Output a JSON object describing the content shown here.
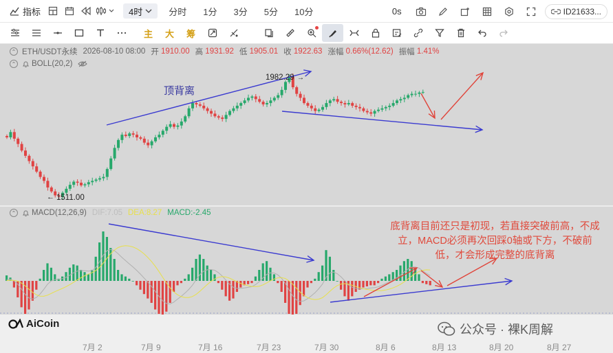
{
  "toolbar": {
    "indicator_label": "指标",
    "timeframes": [
      "4时",
      "分时",
      "1分",
      "3分",
      "5分",
      "10分"
    ],
    "active_timeframe": "4时",
    "countdown": "0s",
    "account": "ID21633..."
  },
  "drawbar": {
    "chinese_buttons": [
      "主",
      "大",
      "筹"
    ]
  },
  "legend": {
    "pair": "ETH/USDT永续",
    "datetime": "2026-08-10 08:00",
    "open_label": "开",
    "open": "1910.00",
    "high_label": "高",
    "high": "1931.92",
    "low_label": "低",
    "low": "1905.01",
    "close_label": "收",
    "close": "1922.63",
    "change_label": "涨幅",
    "change": "0.66%(12.62)",
    "amplitude_label": "振幅",
    "amplitude": "1.41%",
    "boll": "BOLL(20,2)",
    "macd": "MACD(12,26,9)",
    "dif": "DIF:7.05",
    "dea": "DEA:8.27",
    "macd_val": "MACD:-2.45"
  },
  "annotations": {
    "top_divergence": "顶背离",
    "high_price": "1982.29",
    "low_price": "1511.00",
    "bottom_note": "底背离目前还只是初现，若直接突破前高，不成立，MACD必须再次回踩0轴或下方，不破前低，才会形成完整的底背离"
  },
  "x_axis": [
    "7月 2",
    "7月 9",
    "7月 16",
    "7月 23",
    "7月 30",
    "8月 6",
    "8月 13",
    "8月 20",
    "8月 27"
  ],
  "brand": {
    "logo_text": "AiCoin",
    "watermark": "公众号 · 裸K周解"
  },
  "colors": {
    "up": "#27a86b",
    "down": "#e04343",
    "arrow_blue": "#3a3ad0",
    "arrow_red": "#e0443a",
    "dif": "#b0b0b0",
    "dea": "#e8e04a"
  },
  "chart_data": [
    {
      "type": "candlestick",
      "title": "",
      "high_label": "1982.29",
      "low_label": "1511.00",
      "close": [
        1750,
        1770,
        1745,
        1725,
        1700,
        1680,
        1660,
        1640,
        1620,
        1600,
        1585,
        1560,
        1545,
        1530,
        1525,
        1540,
        1555,
        1570,
        1582,
        1578,
        1568,
        1572,
        1580,
        1585,
        1590,
        1595,
        1600,
        1630,
        1670,
        1710,
        1740,
        1760,
        1755,
        1765,
        1760,
        1750,
        1745,
        1730,
        1720,
        1735,
        1750,
        1760,
        1775,
        1790,
        1800,
        1790,
        1795,
        1810,
        1830,
        1860,
        1880,
        1875,
        1870,
        1860,
        1850,
        1840,
        1830,
        1825,
        1820,
        1835,
        1850,
        1860,
        1870,
        1880,
        1890,
        1900,
        1905,
        1895,
        1885,
        1875,
        1880,
        1890,
        1900,
        1910,
        1930,
        1960,
        1980,
        1940,
        1915,
        1900,
        1880,
        1870,
        1860,
        1850,
        1855,
        1865,
        1880,
        1890,
        1895,
        1885,
        1880,
        1875,
        1880,
        1870,
        1865,
        1860,
        1850,
        1845,
        1840,
        1850,
        1855,
        1860,
        1865,
        1870,
        1880,
        1890,
        1895,
        1900,
        1910,
        1915,
        1915,
        1920,
        1922
      ],
      "macd_hist": [
        5,
        3,
        -6,
        -15,
        -24,
        -30,
        -26,
        -18,
        -8,
        2,
        10,
        16,
        12,
        6,
        2,
        4,
        8,
        12,
        15,
        14,
        10,
        8,
        6,
        10,
        22,
        35,
        45,
        40,
        30,
        20,
        10,
        6,
        4,
        2,
        0,
        -4,
        -8,
        -12,
        -16,
        -20,
        -26,
        -30,
        -32,
        -28,
        -20,
        -10,
        -4,
        -2,
        2,
        6,
        12,
        20,
        24,
        20,
        14,
        10,
        6,
        -2,
        -8,
        -14,
        -18,
        -16,
        -10,
        -6,
        -4,
        -3,
        -2,
        4,
        10,
        16,
        18,
        12,
        6,
        -2,
        -10,
        -20,
        -30,
        -34,
        -30,
        -22,
        -14,
        -6,
        -2,
        2,
        8,
        14,
        28,
        22,
        10,
        0,
        -8,
        -14,
        -18,
        -14,
        -10,
        -8,
        -6,
        -5,
        -4,
        -4,
        -2,
        2,
        4,
        6,
        8,
        10,
        14,
        18,
        20,
        18,
        12,
        6,
        -2,
        -3,
        -4
      ]
    }
  ]
}
